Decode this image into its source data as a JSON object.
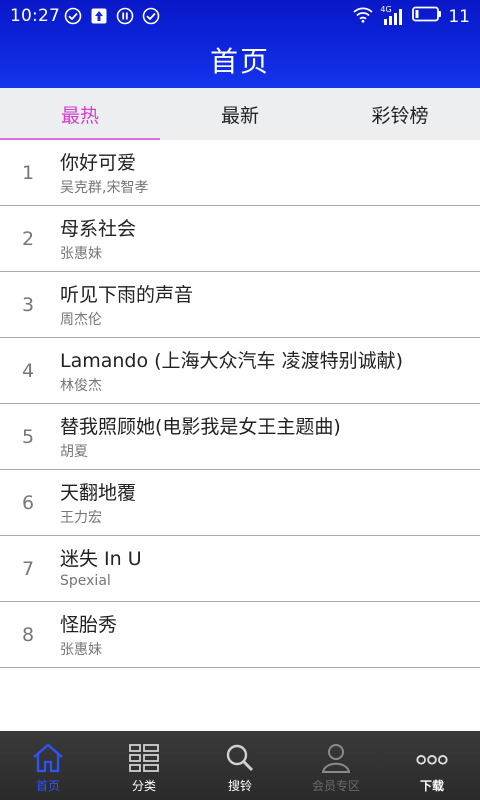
{
  "status_bar": {
    "time": "10:27",
    "network": "4G",
    "battery": "11",
    "left_icons": [
      "check-circle-icon",
      "upload-icon",
      "pause-circle-icon",
      "check-circle-icon"
    ]
  },
  "header": {
    "title": "首页",
    "gradient_top": "#0a18c8",
    "gradient_bottom": "#1435ee"
  },
  "tabs": [
    {
      "label": "最热",
      "active": true
    },
    {
      "label": "最新",
      "active": false
    },
    {
      "label": "彩铃榜",
      "active": false
    }
  ],
  "accent_color": "#d53fd0",
  "songs": [
    {
      "rank": "1",
      "title": "你好可爱",
      "artist": "吴克群,宋智孝"
    },
    {
      "rank": "2",
      "title": "母系社会",
      "artist": "张惠妹"
    },
    {
      "rank": "3",
      "title": "听见下雨的声音",
      "artist": "周杰伦"
    },
    {
      "rank": "4",
      "title": "Lamando (上海大众汽车 凌渡特别诚献)",
      "artist": "林俊杰"
    },
    {
      "rank": "5",
      "title": "替我照顾她(电影我是女王主题曲)",
      "artist": "胡夏"
    },
    {
      "rank": "6",
      "title": "天翻地覆",
      "artist": "王力宏"
    },
    {
      "rank": "7",
      "title": "迷失 In U",
      "artist": "Spexial"
    },
    {
      "rank": "8",
      "title": "怪胎秀",
      "artist": "张惠妹"
    }
  ],
  "bottom_nav": [
    {
      "label": "首页",
      "icon": "home-icon",
      "state": "active"
    },
    {
      "label": "分类",
      "icon": "grid-icon",
      "state": "normal"
    },
    {
      "label": "搜铃",
      "icon": "search-icon",
      "state": "normal"
    },
    {
      "label": "会员专区",
      "icon": "user-icon",
      "state": "dim"
    },
    {
      "label": "下载",
      "icon": "more-icon",
      "state": "bold"
    }
  ]
}
